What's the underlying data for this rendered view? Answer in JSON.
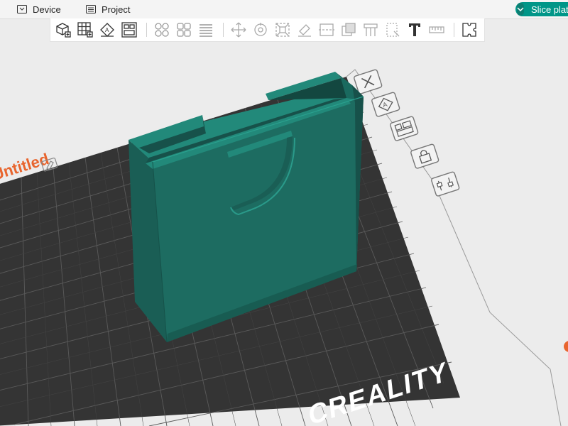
{
  "topbar": {
    "device_label": "Device",
    "project_label": "Project",
    "slice_button_label": "Slice plate"
  },
  "toolbar": {
    "tools": [
      "add-object-icon",
      "add-plate-icon",
      "auto-orient-icon",
      "arrange-icon",
      "split-objects-icon",
      "split-parts-icon",
      "variable-layer-icon",
      "move-icon",
      "rotate-icon",
      "scale-icon",
      "lay-on-face-icon",
      "cut-icon",
      "mesh-boolean-icon",
      "support-paint-icon",
      "seam-paint-icon",
      "text-icon",
      "measure-icon",
      "assembly-icon"
    ]
  },
  "plate": {
    "label": "Untitled",
    "brand_text": "CREALITY"
  },
  "plate_tools": [
    "delete-plate-icon",
    "auto-orient-plate-icon",
    "arrange-plate-icon",
    "lock-plate-icon",
    "plate-settings-icon"
  ],
  "colors": {
    "model": "#1f6f63",
    "bed": "#3a3a3a",
    "accent": "#009688",
    "label_orange": "#e8652e"
  }
}
